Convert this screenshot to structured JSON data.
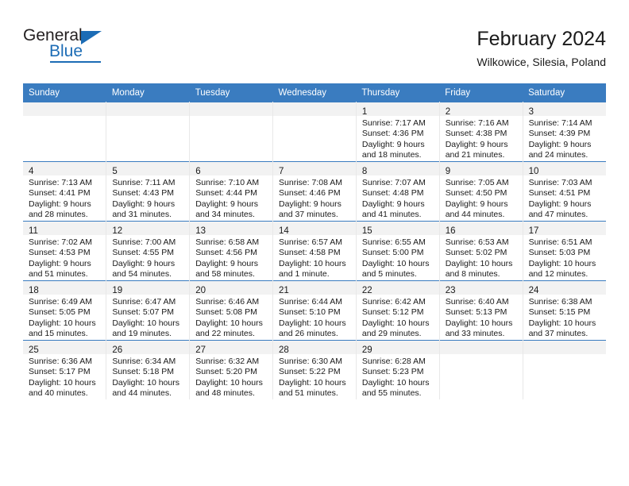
{
  "brand": {
    "name_top": "General",
    "name_bottom": "Blue",
    "accent_color": "#1c6cb5"
  },
  "header": {
    "title": "February 2024",
    "subtitle": "Wilkowice, Silesia, Poland"
  },
  "theme": {
    "header_row_bg": "#3a7cc0",
    "daynum_band_bg": "#f2f2f2",
    "grid_line": "#e8e8e8",
    "row_divider": "#3a7cc0",
    "text": "#1a1a1a"
  },
  "weekday_headers": [
    "Sunday",
    "Monday",
    "Tuesday",
    "Wednesday",
    "Thursday",
    "Friday",
    "Saturday"
  ],
  "weeks": [
    [
      {
        "day": "",
        "lines": []
      },
      {
        "day": "",
        "lines": []
      },
      {
        "day": "",
        "lines": []
      },
      {
        "day": "",
        "lines": []
      },
      {
        "day": "1",
        "lines": [
          "Sunrise: 7:17 AM",
          "Sunset: 4:36 PM",
          "Daylight: 9 hours",
          "and 18 minutes."
        ]
      },
      {
        "day": "2",
        "lines": [
          "Sunrise: 7:16 AM",
          "Sunset: 4:38 PM",
          "Daylight: 9 hours",
          "and 21 minutes."
        ]
      },
      {
        "day": "3",
        "lines": [
          "Sunrise: 7:14 AM",
          "Sunset: 4:39 PM",
          "Daylight: 9 hours",
          "and 24 minutes."
        ]
      }
    ],
    [
      {
        "day": "4",
        "lines": [
          "Sunrise: 7:13 AM",
          "Sunset: 4:41 PM",
          "Daylight: 9 hours",
          "and 28 minutes."
        ]
      },
      {
        "day": "5",
        "lines": [
          "Sunrise: 7:11 AM",
          "Sunset: 4:43 PM",
          "Daylight: 9 hours",
          "and 31 minutes."
        ]
      },
      {
        "day": "6",
        "lines": [
          "Sunrise: 7:10 AM",
          "Sunset: 4:44 PM",
          "Daylight: 9 hours",
          "and 34 minutes."
        ]
      },
      {
        "day": "7",
        "lines": [
          "Sunrise: 7:08 AM",
          "Sunset: 4:46 PM",
          "Daylight: 9 hours",
          "and 37 minutes."
        ]
      },
      {
        "day": "8",
        "lines": [
          "Sunrise: 7:07 AM",
          "Sunset: 4:48 PM",
          "Daylight: 9 hours",
          "and 41 minutes."
        ]
      },
      {
        "day": "9",
        "lines": [
          "Sunrise: 7:05 AM",
          "Sunset: 4:50 PM",
          "Daylight: 9 hours",
          "and 44 minutes."
        ]
      },
      {
        "day": "10",
        "lines": [
          "Sunrise: 7:03 AM",
          "Sunset: 4:51 PM",
          "Daylight: 9 hours",
          "and 47 minutes."
        ]
      }
    ],
    [
      {
        "day": "11",
        "lines": [
          "Sunrise: 7:02 AM",
          "Sunset: 4:53 PM",
          "Daylight: 9 hours",
          "and 51 minutes."
        ]
      },
      {
        "day": "12",
        "lines": [
          "Sunrise: 7:00 AM",
          "Sunset: 4:55 PM",
          "Daylight: 9 hours",
          "and 54 minutes."
        ]
      },
      {
        "day": "13",
        "lines": [
          "Sunrise: 6:58 AM",
          "Sunset: 4:56 PM",
          "Daylight: 9 hours",
          "and 58 minutes."
        ]
      },
      {
        "day": "14",
        "lines": [
          "Sunrise: 6:57 AM",
          "Sunset: 4:58 PM",
          "Daylight: 10 hours",
          "and 1 minute."
        ]
      },
      {
        "day": "15",
        "lines": [
          "Sunrise: 6:55 AM",
          "Sunset: 5:00 PM",
          "Daylight: 10 hours",
          "and 5 minutes."
        ]
      },
      {
        "day": "16",
        "lines": [
          "Sunrise: 6:53 AM",
          "Sunset: 5:02 PM",
          "Daylight: 10 hours",
          "and 8 minutes."
        ]
      },
      {
        "day": "17",
        "lines": [
          "Sunrise: 6:51 AM",
          "Sunset: 5:03 PM",
          "Daylight: 10 hours",
          "and 12 minutes."
        ]
      }
    ],
    [
      {
        "day": "18",
        "lines": [
          "Sunrise: 6:49 AM",
          "Sunset: 5:05 PM",
          "Daylight: 10 hours",
          "and 15 minutes."
        ]
      },
      {
        "day": "19",
        "lines": [
          "Sunrise: 6:47 AM",
          "Sunset: 5:07 PM",
          "Daylight: 10 hours",
          "and 19 minutes."
        ]
      },
      {
        "day": "20",
        "lines": [
          "Sunrise: 6:46 AM",
          "Sunset: 5:08 PM",
          "Daylight: 10 hours",
          "and 22 minutes."
        ]
      },
      {
        "day": "21",
        "lines": [
          "Sunrise: 6:44 AM",
          "Sunset: 5:10 PM",
          "Daylight: 10 hours",
          "and 26 minutes."
        ]
      },
      {
        "day": "22",
        "lines": [
          "Sunrise: 6:42 AM",
          "Sunset: 5:12 PM",
          "Daylight: 10 hours",
          "and 29 minutes."
        ]
      },
      {
        "day": "23",
        "lines": [
          "Sunrise: 6:40 AM",
          "Sunset: 5:13 PM",
          "Daylight: 10 hours",
          "and 33 minutes."
        ]
      },
      {
        "day": "24",
        "lines": [
          "Sunrise: 6:38 AM",
          "Sunset: 5:15 PM",
          "Daylight: 10 hours",
          "and 37 minutes."
        ]
      }
    ],
    [
      {
        "day": "25",
        "lines": [
          "Sunrise: 6:36 AM",
          "Sunset: 5:17 PM",
          "Daylight: 10 hours",
          "and 40 minutes."
        ]
      },
      {
        "day": "26",
        "lines": [
          "Sunrise: 6:34 AM",
          "Sunset: 5:18 PM",
          "Daylight: 10 hours",
          "and 44 minutes."
        ]
      },
      {
        "day": "27",
        "lines": [
          "Sunrise: 6:32 AM",
          "Sunset: 5:20 PM",
          "Daylight: 10 hours",
          "and 48 minutes."
        ]
      },
      {
        "day": "28",
        "lines": [
          "Sunrise: 6:30 AM",
          "Sunset: 5:22 PM",
          "Daylight: 10 hours",
          "and 51 minutes."
        ]
      },
      {
        "day": "29",
        "lines": [
          "Sunrise: 6:28 AM",
          "Sunset: 5:23 PM",
          "Daylight: 10 hours",
          "and 55 minutes."
        ]
      },
      {
        "day": "",
        "lines": []
      },
      {
        "day": "",
        "lines": []
      }
    ]
  ]
}
